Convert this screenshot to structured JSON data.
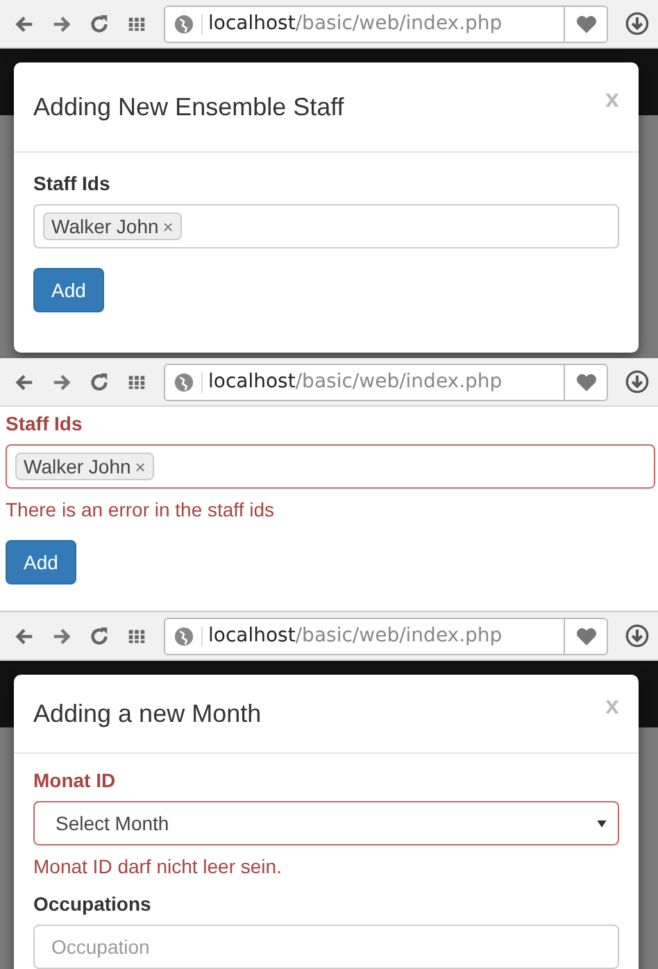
{
  "panels": [
    {
      "kind": "modal",
      "browser": {
        "host": "localhost",
        "path": "/basic/web/index.php"
      },
      "title": "Adding New Ensemble Staff",
      "close": "x",
      "fields": [
        {
          "kind": "tags",
          "label": "Staff Ids",
          "error": false,
          "tags": [
            {
              "text": "Walker John",
              "remove": "×"
            }
          ]
        }
      ],
      "button": "Add"
    },
    {
      "kind": "plain",
      "browser": {
        "host": "localhost",
        "path": "/basic/web/index.php"
      },
      "fields": [
        {
          "kind": "tags",
          "label": "Staff Ids",
          "error": true,
          "tags": [
            {
              "text": "Walker John",
              "remove": "×"
            }
          ],
          "message": "There is an error in the staff ids"
        }
      ],
      "button": "Add"
    },
    {
      "kind": "modal",
      "browser": {
        "host": "localhost",
        "path": "/basic/web/index.php"
      },
      "title": "Adding a new Month",
      "close": "x",
      "fields": [
        {
          "kind": "select",
          "label": "Monat ID",
          "error": true,
          "value": "Select Month",
          "message": "Monat ID darf nicht leer sein."
        },
        {
          "kind": "text",
          "label": "Occupations",
          "error": false,
          "placeholder": "Occupation"
        }
      ]
    }
  ]
}
